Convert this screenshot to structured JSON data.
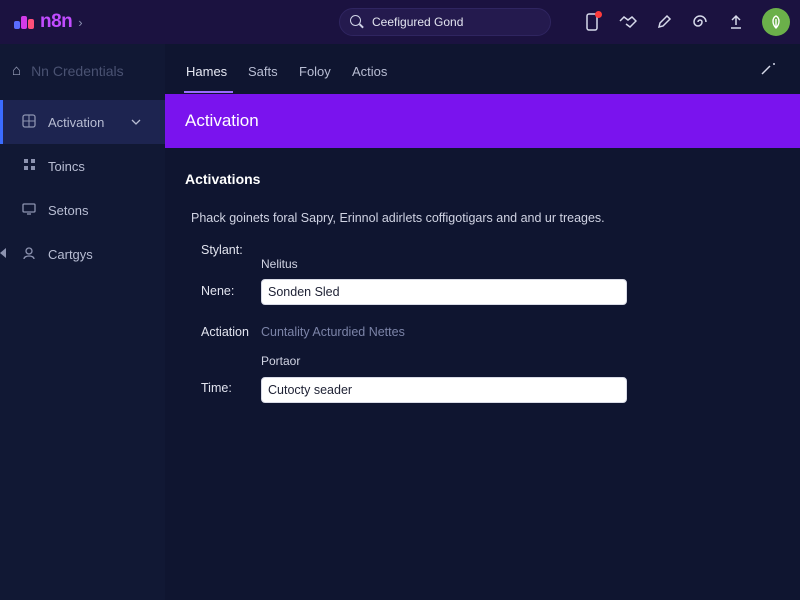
{
  "header": {
    "logo_text": "n8n",
    "logo_chevron": "›",
    "search": {
      "value": "Ceefigured Gond"
    },
    "icons": [
      "phone-icon",
      "handshake-icon",
      "pen-icon",
      "spiral-icon",
      "upload-icon"
    ],
    "avatar_icon": "leaf-icon"
  },
  "sidebar": {
    "title": "Nn Credentials",
    "items": [
      {
        "label": "Activation",
        "icon": "puzzle-icon",
        "active": true
      },
      {
        "label": "Toincs",
        "icon": "grid-icon"
      },
      {
        "label": "Setons",
        "icon": "monitor-icon"
      },
      {
        "label": "Cartgys",
        "icon": "users-icon"
      }
    ]
  },
  "tabs": [
    {
      "label": "Hames",
      "active": true
    },
    {
      "label": "Safts"
    },
    {
      "label": "Foloy"
    },
    {
      "label": "Actios"
    }
  ],
  "banner": {
    "title": "Activation"
  },
  "content": {
    "section_title": "Activations",
    "description": "Phack goinets foral Sapry, Erinnol adirlets coffigotigars and and ur treages.",
    "signature_label": "Stylant:",
    "status_sub": "Nelitus",
    "name_label": "Nene:",
    "name_value": "Sonden Sled",
    "activation_label": "Actiation",
    "activation_value": "Cuntality Acturdied Nettes",
    "portor_sub": "Portaor",
    "time_label": "Time:",
    "time_value": "Cutocty seader"
  },
  "colors": {
    "topbar": "#1b1240",
    "banner": "#7a13ee",
    "accent": "#3b6cff",
    "logo": "#c14cff"
  }
}
